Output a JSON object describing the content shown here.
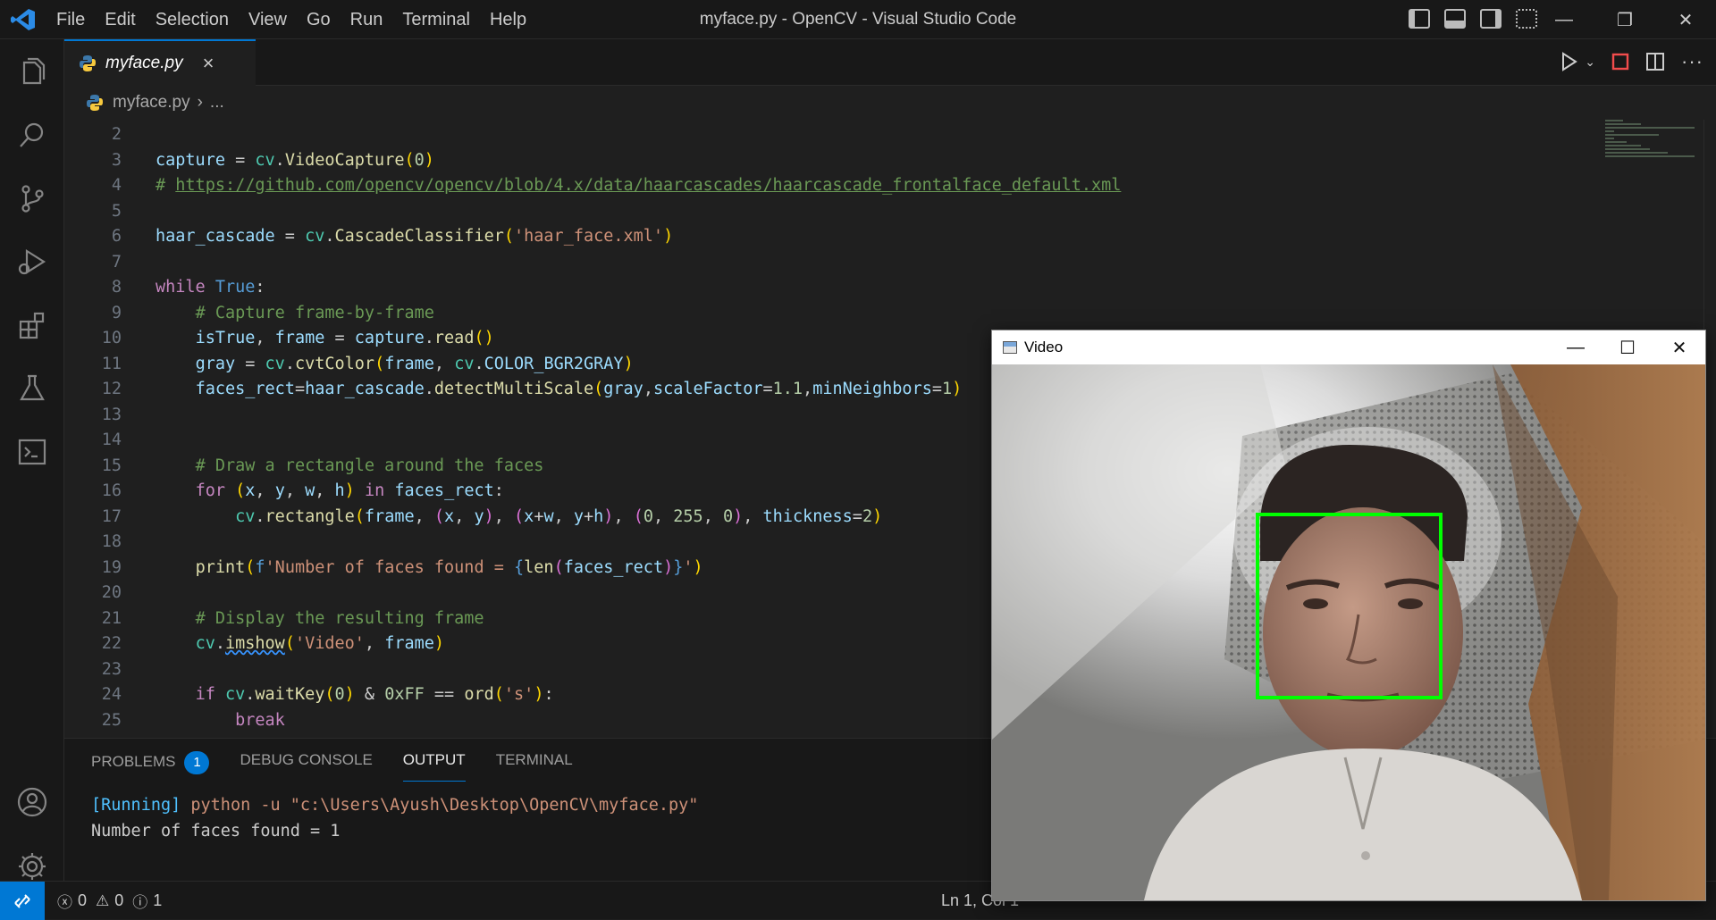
{
  "window": {
    "title": "myface.py - OpenCV - Visual Studio Code",
    "menu": [
      "File",
      "Edit",
      "Selection",
      "View",
      "Go",
      "Run",
      "Terminal",
      "Help"
    ]
  },
  "activity_bar": {
    "icons": [
      "explorer-icon",
      "search-icon",
      "source-control-icon",
      "run-debug-icon",
      "extensions-icon",
      "testing-icon",
      "remote-explorer-icon",
      "accounts-icon",
      "manage-gear-icon"
    ]
  },
  "tab": {
    "label": "myface.py",
    "close": "×"
  },
  "breadcrumb": {
    "file": "myface.py",
    "sep": "›",
    "more": "..."
  },
  "editor": {
    "line_numbers": [
      "2",
      "3",
      "4",
      "5",
      "6",
      "7",
      "8",
      "9",
      "10",
      "11",
      "12",
      "13",
      "14",
      "15",
      "16",
      "17",
      "18",
      "19",
      "20",
      "21",
      "22",
      "23",
      "24",
      "25"
    ]
  },
  "panel": {
    "tabs": [
      "PROBLEMS",
      "DEBUG CONSOLE",
      "OUTPUT",
      "TERMINAL"
    ],
    "problems_count": "1",
    "output_running": "[Running]",
    "output_command": " python -u \"c:\\Users\\Ayush\\Desktop\\OpenCV\\myface.py\"",
    "output_line2": "Number of faces found = 1"
  },
  "status": {
    "errors": "0",
    "warnings": "0",
    "info": "1",
    "position": "Ln 1, Col 1"
  },
  "video_window": {
    "title": "Video",
    "minimize": "—",
    "maximize": "☐",
    "close": "✕"
  },
  "colors": {
    "accent": "#0078d4",
    "face_box": "#00ff00"
  }
}
